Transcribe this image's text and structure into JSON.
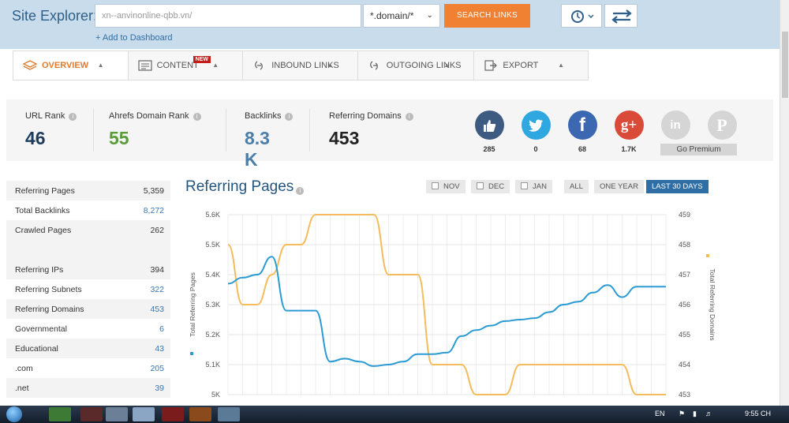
{
  "header": {
    "title": "Site Explorer:",
    "url_value": "xn--anvinonline-qbb.vn/",
    "mode_value": "*.domain/*",
    "search_label": "SEARCH LINKS",
    "add_dashboard": "+ Add to Dashboard"
  },
  "tabs": [
    {
      "label": "OVERVIEW",
      "icon": "layers-icon",
      "active": true
    },
    {
      "label": "CONTENT",
      "icon": "content-icon",
      "badge": "NEW"
    },
    {
      "label": "INBOUND LINKS",
      "icon": "inbound-links-icon"
    },
    {
      "label": "OUTGOING LINKS",
      "icon": "outgoing-links-icon"
    },
    {
      "label": "EXPORT",
      "icon": "export-icon"
    }
  ],
  "stats": {
    "url_rank": {
      "label": "URL Rank",
      "value": "46",
      "color": "#1d3c5c"
    },
    "domain_rank": {
      "label": "Ahrefs Domain Rank",
      "value": "55",
      "color": "#5a9b3a"
    },
    "backlinks": {
      "label": "Backlinks",
      "value": "8.3 K",
      "color": "#4b7ea8"
    },
    "ref_domains": {
      "label": "Referring Domains",
      "value": "453",
      "color": "#222222"
    }
  },
  "social": [
    {
      "name": "like-icon",
      "count": "285",
      "color": "#3d5a80"
    },
    {
      "name": "twitter-icon",
      "count": "0",
      "color": "#2fa7e0"
    },
    {
      "name": "facebook-icon",
      "count": "68",
      "color": "#3b68b0"
    },
    {
      "name": "google-plus-icon",
      "count": "1.7K",
      "color": "#d94a38"
    },
    {
      "name": "linkedin-icon",
      "count": "",
      "color": "#d5d5d5"
    },
    {
      "name": "pinterest-icon",
      "count": "",
      "color": "#d5d5d5"
    }
  ],
  "go_premium": "Go Premium",
  "metrics": [
    {
      "label": "Referring Pages",
      "value": "5,359",
      "blue": false
    },
    {
      "label": "Total Backlinks",
      "value": "8,272",
      "blue": true
    },
    {
      "label": "Crawled Pages",
      "value": "262",
      "blue": false
    },
    {
      "label": "Referring IPs",
      "value": "394",
      "blue": false
    },
    {
      "label": "Referring Subnets",
      "value": "322",
      "blue": true
    },
    {
      "label": "Referring Domains",
      "value": "453",
      "blue": true
    },
    {
      "label": "Governmental",
      "value": "6",
      "blue": true
    },
    {
      "label": "Educational",
      "value": "43",
      "blue": true
    },
    {
      "label": ".com",
      "value": "205",
      "blue": true
    },
    {
      "label": ".net",
      "value": "39",
      "blue": true
    }
  ],
  "chart": {
    "title": "Referring Pages",
    "period_buttons": {
      "nov": "NOV",
      "dec": "DEC",
      "jan": "JAN",
      "all": "ALL",
      "one_year": "ONE YEAR",
      "last30": "LAST 30 DAYS"
    }
  },
  "chart_data": {
    "type": "line",
    "ylabel_left": "Total Referring Pages",
    "ylabel_right": "Total Referring Domains",
    "ylim_left": [
      5000,
      5600
    ],
    "ylim_right": [
      453,
      459
    ],
    "left_ticks": [
      "5K",
      "5.1K",
      "5.2K",
      "5.3K",
      "5.4K",
      "5.5K",
      "5.6K"
    ],
    "right_ticks": [
      "453",
      "454",
      "455",
      "456",
      "457",
      "458",
      "459"
    ],
    "x": [
      0,
      1,
      2,
      3,
      4,
      5,
      6,
      7,
      8,
      9,
      10,
      11,
      12,
      13,
      14,
      15,
      16,
      17,
      18,
      19,
      20,
      21,
      22,
      23,
      24,
      25,
      26,
      27,
      28,
      29,
      30
    ],
    "series": [
      {
        "name": "Total Referring Pages",
        "color": "#2b9bd3",
        "values": [
          5370,
          5390,
          5400,
          5460,
          5280,
          5280,
          5280,
          5110,
          5120,
          5110,
          5095,
          5100,
          5110,
          5135,
          5135,
          5140,
          5195,
          5215,
          5230,
          5245,
          5250,
          5255,
          5275,
          5300,
          5310,
          5340,
          5365,
          5325,
          5360,
          5360,
          5360
        ]
      },
      {
        "name": "Total Referring Domains",
        "color": "#f5bc5c",
        "values": [
          458,
          456,
          456,
          457,
          458,
          458,
          459,
          459,
          459,
          459,
          459,
          457,
          457,
          457,
          454,
          454,
          454,
          453,
          453,
          453,
          454,
          454,
          454,
          454,
          454,
          454,
          454,
          454,
          453,
          453,
          453
        ]
      }
    ]
  },
  "taskbar": {
    "lang": "EN",
    "time": "9:55 CH"
  }
}
